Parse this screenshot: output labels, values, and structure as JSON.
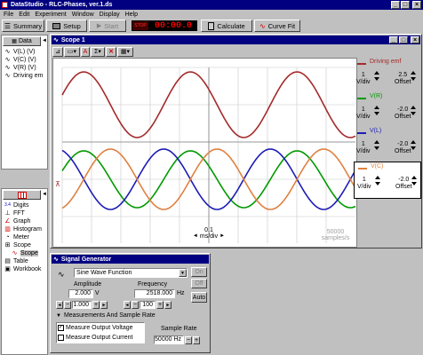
{
  "app": {
    "title": "DataStudio - RLC-Phases, ver.1.ds",
    "menu": [
      "File",
      "Edit",
      "Experiment",
      "Window",
      "Display",
      "Help"
    ],
    "toolbar": {
      "summary": "Summary",
      "setup": "Setup",
      "start": "Start",
      "stop_label": "STOP",
      "timer": "00:00.0",
      "calculate": "Calculate",
      "curvefit": "Curve Fit"
    }
  },
  "data_panel": {
    "button": "Data",
    "items": [
      "V(L) (V)",
      "V(C) (V)",
      "V(R) (V)",
      "Driving em"
    ]
  },
  "displays_panel": {
    "items": [
      "Digits",
      "FFT",
      "Graph",
      "Histogram",
      "Meter",
      "Scope",
      "Scope",
      "Table",
      "Workbook"
    ]
  },
  "scope": {
    "title": "Scope 1",
    "time_value": "0.1",
    "time_unit": "ms/div",
    "sample_rate": "50000",
    "sample_unit": "samples/s",
    "legend": [
      {
        "name": "Driving emf",
        "color": "#a52a2a",
        "vdiv": "1",
        "vdiv_unit": "V/div",
        "offset": "2.5",
        "offset_label": "Offset"
      },
      {
        "name": "V(R)",
        "color": "#009900",
        "vdiv": "1",
        "vdiv_unit": "V/div",
        "offset": "-2.0",
        "offset_label": "Offset"
      },
      {
        "name": "V(L)",
        "color": "#1c1cb4",
        "vdiv": "1",
        "vdiv_unit": "V/div",
        "offset": "-2.0",
        "offset_label": "Offset"
      },
      {
        "name": "V(C)",
        "color": "#e08040",
        "vdiv": "1",
        "vdiv_unit": "V/div",
        "offset": "-2.0",
        "offset_label": "Offset"
      }
    ]
  },
  "siggen": {
    "title": "Signal Generator",
    "waveform": "Sine Wave Function",
    "on": "On",
    "off": "Off",
    "auto": "Auto",
    "amplitude_label": "Amplitude",
    "amplitude_value": "2.000",
    "amplitude_unit": "V",
    "frequency_label": "Frequency",
    "frequency_value": "2518.000",
    "frequency_unit": "Hz",
    "amp_step": "1.000",
    "freq_step": "100",
    "measure_header": "Measurements And Sample Rate",
    "measure_voltage": "Measure Output Voltage",
    "measure_current": "Measure Output Current",
    "sample_rate_label": "Sample Rate",
    "sample_rate_value": "50000 Hz"
  }
}
